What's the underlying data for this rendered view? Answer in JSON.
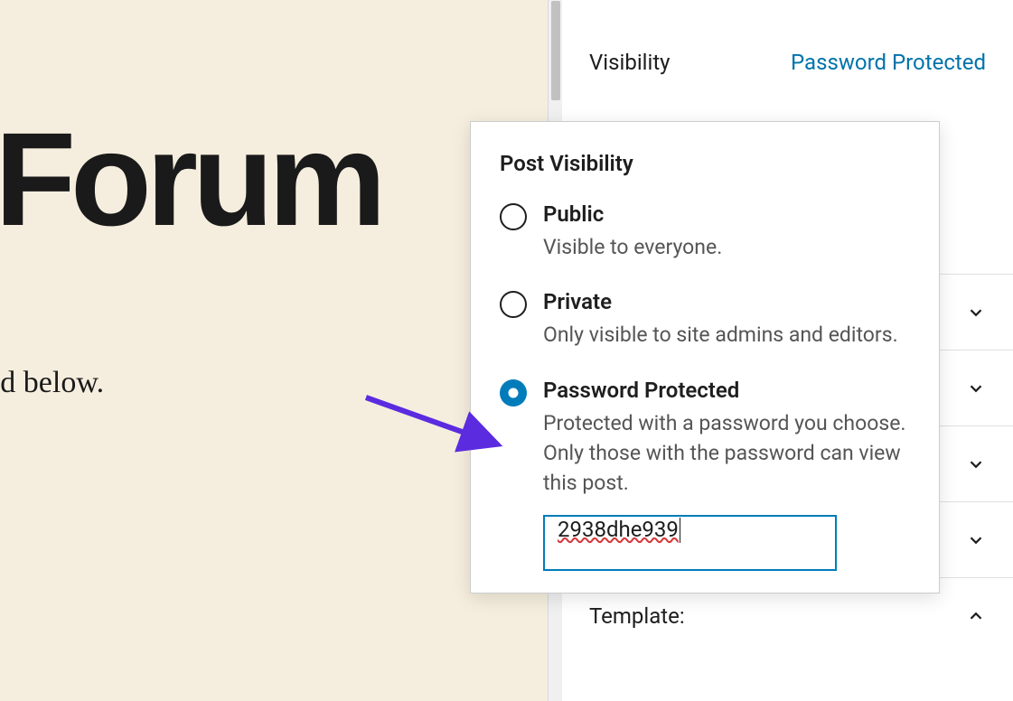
{
  "content": {
    "title": "nly Forum",
    "instruction": "in the field below."
  },
  "sidebar": {
    "visibility_label": "Visibility",
    "visibility_value": "Password Protected",
    "template_label": "Template:"
  },
  "popover": {
    "title": "Post Visibility",
    "options": {
      "public": {
        "title": "Public",
        "desc": "Visible to everyone."
      },
      "private": {
        "title": "Private",
        "desc": "Only visible to site admins and editors."
      },
      "password": {
        "title": "Password Protected",
        "desc": "Protected with a password you choose. Only those with the password can view this post."
      }
    },
    "password_value": "2938dhe939"
  }
}
